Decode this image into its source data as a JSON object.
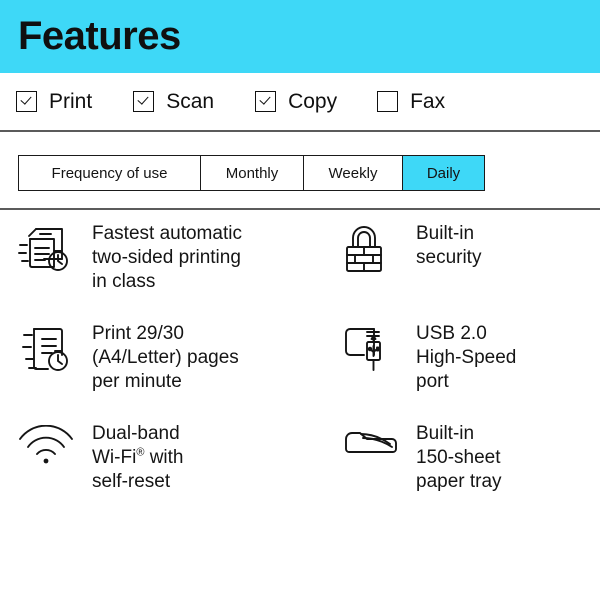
{
  "header": {
    "title": "Features",
    "background_color": "#3ed8f7"
  },
  "checkboxes": [
    {
      "label": "Print",
      "checked": true,
      "icon": "checkbox-checked-icon"
    },
    {
      "label": "Scan",
      "checked": true,
      "icon": "checkbox-checked-icon"
    },
    {
      "label": "Copy",
      "checked": true,
      "icon": "checkbox-checked-icon"
    },
    {
      "label": "Fax",
      "checked": false,
      "icon": "checkbox-unchecked-icon"
    }
  ],
  "frequency": {
    "row_label": "Frequency of use",
    "options": [
      "Monthly",
      "Weekly",
      "Daily"
    ],
    "selected": "Daily",
    "selected_color": "#3ed8f7"
  },
  "features": [
    {
      "icon": "fast-duplex-print-clock-icon",
      "text": "Fastest automatic\ntwo-sided printing\nin class",
      "column": "left"
    },
    {
      "icon": "lock-security-icon",
      "text": "Built-in\nsecurity",
      "column": "right"
    },
    {
      "icon": "document-speed-clock-icon",
      "text": "Print 29/30\n(A4/Letter) pages\nper minute",
      "column": "left"
    },
    {
      "icon": "usb-port-icon",
      "text": "USB 2.0\nHigh-Speed\nport",
      "column": "right"
    },
    {
      "icon": "wifi-icon",
      "text_before_sup": "Dual-band\nWi-Fi",
      "sup": "®",
      "text_after_sup": " with\nself-reset",
      "column": "left"
    },
    {
      "icon": "paper-tray-icon",
      "text": "Built-in\n150-sheet\npaper tray",
      "column": "right"
    }
  ],
  "colors": {
    "accent": "#3ed8f7",
    "text": "#151515",
    "divider": "#5b5b5b",
    "border": "#1a1a1a"
  }
}
